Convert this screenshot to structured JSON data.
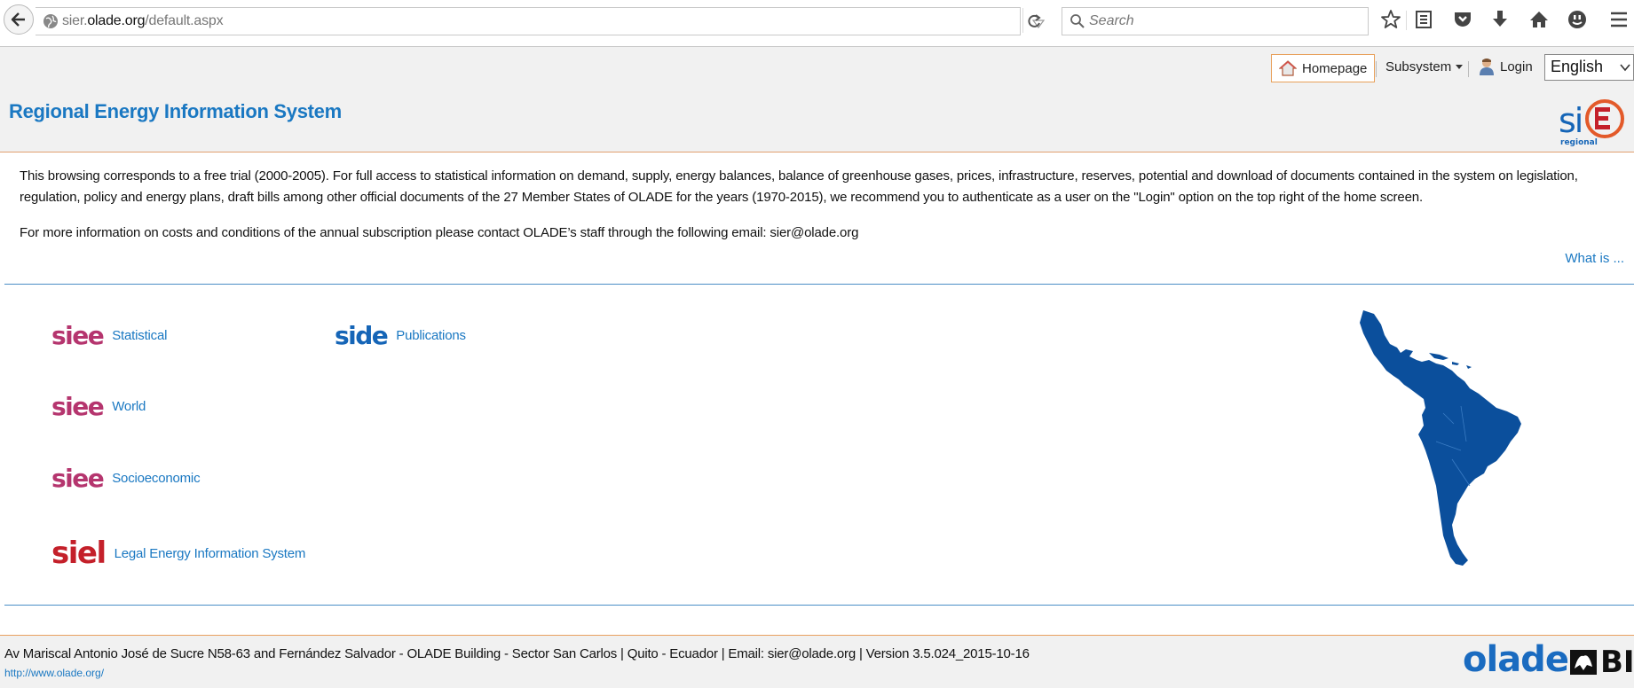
{
  "browser": {
    "url_prefix": "sier.",
    "url_domain": "olade.org",
    "url_path": "/default.aspx",
    "search_placeholder": "Search"
  },
  "header": {
    "homepage_label": "Homepage",
    "subsystem_label": "Subsystem",
    "login_label": "Login",
    "language": "English",
    "site_title": "Regional Energy Information System",
    "logo_main": "si",
    "logo_sub": "regional"
  },
  "notice": {
    "paragraph1": "This browsing corresponds to a free trial (2000-2005). For full access to statistical information on demand, supply, energy balances, balance of greenhouse gases, prices, infrastructure, reserves, potential and download of documents contained in the system on legislation, regulation, policy and energy plans, draft bills among other official documents of the 27 Member States of OLADE for the years (1970-2015), we recommend you to authenticate as a user on the \"Login\" option on the top right of the home screen.",
    "paragraph2": "For more information on costs and conditions of the annual subscription please contact OLADE’s staff through the following email: sier@olade.org",
    "what_is_label": "What is ..."
  },
  "systems": [
    {
      "logo": "siee",
      "label": "Statistical"
    },
    {
      "logo": "siee",
      "label": "World"
    },
    {
      "logo": "siee",
      "label": "Socioeconomic"
    },
    {
      "logo": "siel",
      "label": "Legal Energy Information System"
    },
    {
      "logo": "side",
      "label": "Publications"
    }
  ],
  "footer": {
    "address": "Av Mariscal Antonio José de Sucre N58-63 and Fernández Salvador - OLADE Building - Sector San Carlos | Quito - Ecuador | Email: sier@olade.org | Version 3.5.024_2015-10-16",
    "url": "http://www.olade.org/",
    "olade_logo": "olade",
    "bid_logo": "BID"
  },
  "colors": {
    "accent_blue": "#1a78c2",
    "siee_magenta": "#b5356e",
    "siel_red": "#c4202a",
    "map_blue": "#0b4f9c",
    "header_border_orange": "#e8a060"
  }
}
